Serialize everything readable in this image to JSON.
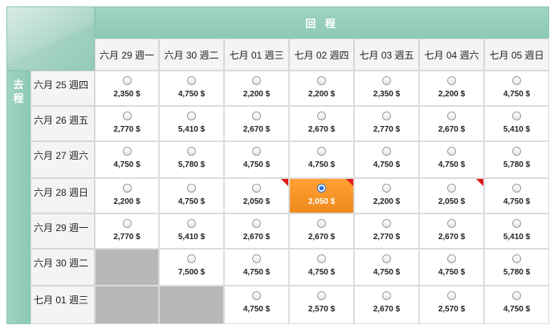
{
  "header": {
    "return_label": "回 程",
    "depart_label_1": "去",
    "depart_label_2": "程"
  },
  "return_dates": [
    "六月 29 週一",
    "六月 30 週二",
    "七月 01 週三",
    "七月 02 週四",
    "七月 03 週五",
    "七月 04 週六",
    "七月 05 週日"
  ],
  "depart_dates": [
    "六月 25 週四",
    "六月 26 週五",
    "六月 27 週六",
    "六月 28 週日",
    "六月 29 週一",
    "六月 30 週二",
    "七月 01 週三"
  ],
  "fares": [
    [
      {
        "p": "2,350 $"
      },
      {
        "p": "4,750 $"
      },
      {
        "p": "2,200 $"
      },
      {
        "p": "2,200 $"
      },
      {
        "p": "2,350 $"
      },
      {
        "p": "2,200 $"
      },
      {
        "p": "4,750 $"
      }
    ],
    [
      {
        "p": "2,770 $"
      },
      {
        "p": "5,410 $"
      },
      {
        "p": "2,670 $"
      },
      {
        "p": "2,670 $"
      },
      {
        "p": "2,770 $"
      },
      {
        "p": "2,670 $"
      },
      {
        "p": "5,410 $"
      }
    ],
    [
      {
        "p": "4,750 $"
      },
      {
        "p": "5,780 $"
      },
      {
        "p": "4,750 $"
      },
      {
        "p": "4,750 $"
      },
      {
        "p": "4,750 $"
      },
      {
        "p": "4,750 $"
      },
      {
        "p": "5,780 $"
      }
    ],
    [
      {
        "p": "2,200 $"
      },
      {
        "p": "4,750 $"
      },
      {
        "p": "2,050 $",
        "flag": true
      },
      {
        "p": "2,050 $",
        "flag": true,
        "selected": true
      },
      {
        "p": "2,200 $"
      },
      {
        "p": "2,050 $",
        "flag": true
      },
      {
        "p": "4,750 $"
      }
    ],
    [
      {
        "p": "2,770 $"
      },
      {
        "p": "5,410 $"
      },
      {
        "p": "2,670 $"
      },
      {
        "p": "2,670 $"
      },
      {
        "p": "2,770 $"
      },
      {
        "p": "2,670 $"
      },
      {
        "p": "5,410 $"
      }
    ],
    [
      {
        "empty": true
      },
      {
        "p": "7,500 $"
      },
      {
        "p": "4,750 $"
      },
      {
        "p": "4,750 $"
      },
      {
        "p": "4,750 $"
      },
      {
        "p": "4,750 $"
      },
      {
        "p": "5,780 $"
      }
    ],
    [
      {
        "empty": true
      },
      {
        "empty": true
      },
      {
        "p": "4,750 $"
      },
      {
        "p": "2,570 $"
      },
      {
        "p": "2,670 $"
      },
      {
        "p": "2,570 $"
      },
      {
        "p": "4,750 $"
      }
    ]
  ],
  "colors": {
    "accent": "#8cc9b4",
    "selected": "#f08a1b",
    "flag": "#e01818",
    "unavailable": "#b8b8b8"
  },
  "icons": {
    "radio": "radio-button-icon",
    "flag": "lowest-fare-flag-icon"
  }
}
